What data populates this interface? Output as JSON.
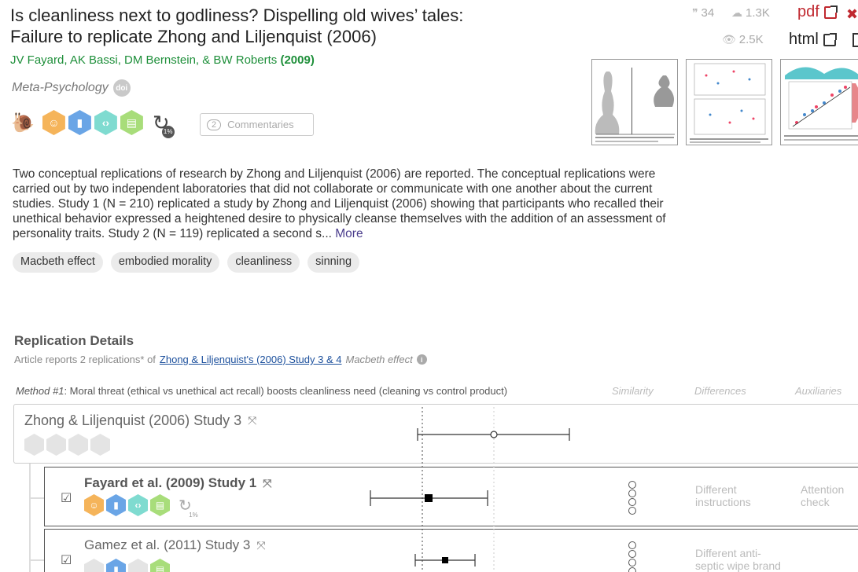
{
  "article": {
    "title_line1": "Is cleanliness next to godliness? Dispelling old wives’ tales:",
    "title_line2": "Failure to replicate Zhong and Liljenquist (2006)",
    "authors": "JV Fayard, AK Bassi, DM Bernstein, & BW Roberts",
    "year": "(2009)",
    "journal": "Meta-Psychology",
    "doi_label": "doi"
  },
  "stats": {
    "citations": "34",
    "downloads": "1.3K",
    "views": "2.5K"
  },
  "links": {
    "pdf": "pdf",
    "html": "html"
  },
  "badges": {
    "replication_pct": "1%",
    "comments_count": "2",
    "comments_label": "Commentaries"
  },
  "abstract": {
    "text": "Two conceptual replications of research by Zhong and Liljenquist (2006) are reported. The conceptual replications were carried out by two independent laboratories that did not collaborate or communicate with one another about the current studies. Study 1 (N = 210) replicated a study by Zhong and Liljenquist (2006) showing that participants who recalled their unethical behavior expressed a heightened desire to physically cleanse themselves with the addition of an assessment of personality traits. Study 2 (N = 119) replicated a second s...",
    "more_label": "More"
  },
  "tags": [
    "Macbeth effect",
    "embodied morality",
    "cleanliness",
    "sinning"
  ],
  "replication": {
    "title": "Replication Details",
    "sub_prefix": "Article reports 2 replications* of",
    "sub_link": "Zhong & Liljenquist's (2006) Study 3 & 4",
    "sub_effect": "Macbeth effect",
    "method_label": "Method #1",
    "method_text": ": Moral threat (ethical vs unethical act recall) boosts cleanliness need (cleaning vs control product)",
    "col_similarity": "Similarity",
    "col_differences": "Differences",
    "col_auxiliaries": "Auxiliaries",
    "original_title": "Zhong & Liljenquist (2006) Study 3",
    "rows": [
      {
        "title": "Fayard et al. (2009) Study 1",
        "replication_pct": "1%",
        "difference": "Different instructions",
        "auxiliary": "Attention check"
      },
      {
        "title": "Gamez et al. (2011) Study 3",
        "difference": "Different anti-septic wipe brand",
        "auxiliary": ""
      }
    ]
  },
  "colors": {
    "author_green": "#1e8f3a",
    "link_blue": "#1b4f9c",
    "badge_orange": "#f5b45a",
    "badge_blue": "#6aa5e6",
    "badge_teal": "#7fdbd0",
    "badge_green": "#a8dd7a",
    "pdf_red": "#c0282f"
  }
}
